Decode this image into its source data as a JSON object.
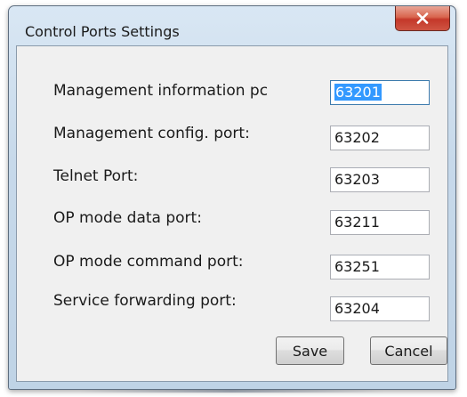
{
  "window": {
    "title": "Control Ports Settings"
  },
  "fields": [
    {
      "label": "Management information pc",
      "value": "63201"
    },
    {
      "label": "Management config. port:",
      "value": "63202"
    },
    {
      "label": "Telnet Port:",
      "value": "63203"
    },
    {
      "label": "OP mode data port:",
      "value": "63211"
    },
    {
      "label": "OP mode command port:",
      "value": "63251"
    },
    {
      "label": "Service forwarding port:",
      "value": "63204"
    }
  ],
  "buttons": {
    "save": "Save",
    "cancel": "Cancel"
  },
  "icons": {
    "close": "close-icon"
  },
  "colors": {
    "close_button": "#c4382a",
    "selection": "#3399ff"
  }
}
